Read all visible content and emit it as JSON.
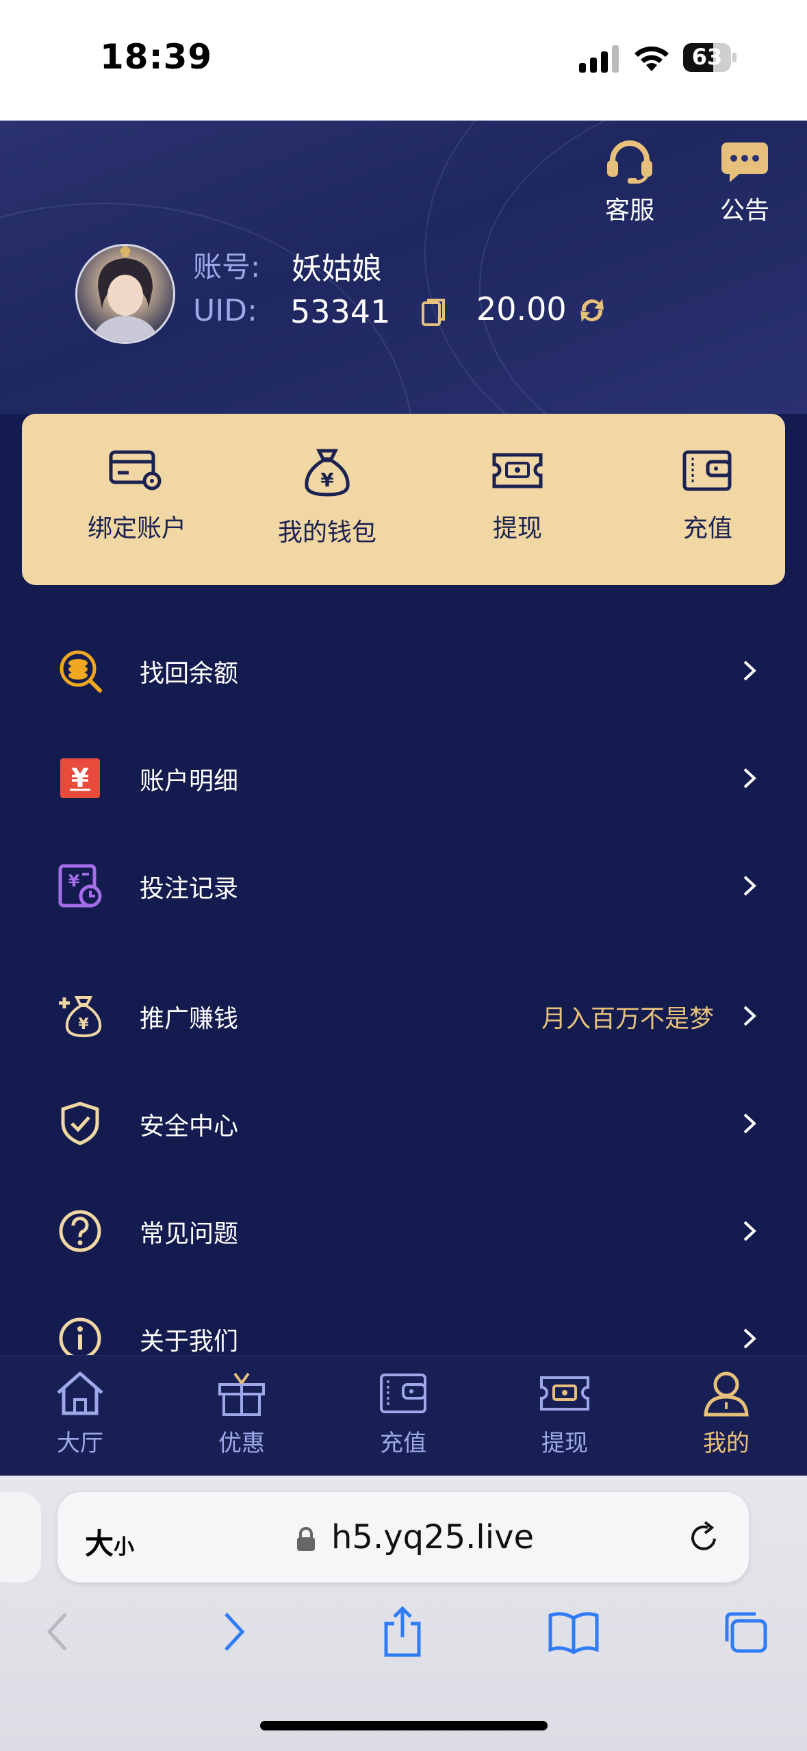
{
  "status_bar": {
    "time": "18:39",
    "battery": "63",
    "battery_level": 0.63
  },
  "header": {
    "service_label": "客服",
    "notice_label": "公告",
    "account_label": "账号:",
    "account_name": "妖姑娘",
    "uid_label": "UID:",
    "uid_value": "53341",
    "balance": "20.00"
  },
  "quick_actions": [
    {
      "label": "绑定账户",
      "icon": "bank-card-settings-icon"
    },
    {
      "label": "我的钱包",
      "icon": "money-bag-icon"
    },
    {
      "label": "提现",
      "icon": "ticket-cash-icon"
    },
    {
      "label": "充值",
      "icon": "wallet-icon"
    }
  ],
  "menu": [
    {
      "label": "找回余额",
      "icon": "coin-search-icon",
      "extra": ""
    },
    {
      "label": "账户明细",
      "icon": "yuan-ledger-icon",
      "extra": ""
    },
    {
      "label": "投注记录",
      "icon": "bet-record-icon",
      "extra": ""
    },
    {
      "label": "推广赚钱",
      "icon": "promote-money-icon",
      "extra": "月入百万不是梦"
    },
    {
      "label": "安全中心",
      "icon": "shield-check-icon",
      "extra": ""
    },
    {
      "label": "常见问题",
      "icon": "question-circle-icon",
      "extra": ""
    },
    {
      "label": "关于我们",
      "icon": "info-circle-icon",
      "extra": ""
    }
  ],
  "tabs": [
    {
      "label": "大厅",
      "icon": "home-icon"
    },
    {
      "label": "优惠",
      "icon": "gift-icon"
    },
    {
      "label": "充值",
      "icon": "wallet-icon"
    },
    {
      "label": "提现",
      "icon": "ticket-cash-icon"
    },
    {
      "label": "我的",
      "icon": "user-icon",
      "active": true
    }
  ],
  "browser": {
    "text_size_big": "大",
    "text_size_small": "小",
    "url": "h5.yq25.live"
  },
  "colors": {
    "header_bg": "#232a66",
    "main_bg": "#141b4f",
    "gold_card": "#f1d7a4",
    "gold_text": "#e7c17b",
    "label_blue": "#9ea8e8"
  }
}
